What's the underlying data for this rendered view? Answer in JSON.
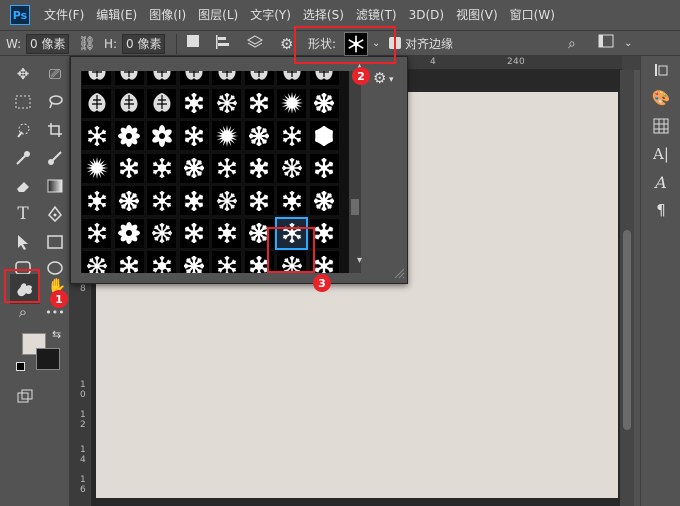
{
  "app": {
    "logo": "Ps"
  },
  "menu": [
    "文件(F)",
    "编辑(E)",
    "图像(I)",
    "图层(L)",
    "文字(Y)",
    "选择(S)",
    "滤镜(T)",
    "3D(D)",
    "视图(V)",
    "窗口(W)"
  ],
  "options": {
    "w_label": "W:",
    "w_value": "0 像素",
    "h_label": "H:",
    "h_value": "0 像素",
    "shape_label": "形状:",
    "align_edges_label": "对齐边缘"
  },
  "rulers": {
    "top": [
      "4",
      "2",
      "4",
      "0"
    ],
    "left": [
      "8",
      "1",
      "0",
      "1",
      "2",
      "1",
      "4",
      "1",
      "6"
    ]
  },
  "annotations": [
    "1",
    "2",
    "3"
  ],
  "colors": {
    "ui_bg": "#535353",
    "canvas": "#e1dbd5",
    "highlight": "#e8232a",
    "selection": "#31a8ff",
    "foreground_swatch": "#e1dbd5",
    "background_swatch": "#1a1a1a"
  },
  "shape_grid": {
    "rows": 7,
    "cols": 8,
    "selected_row": 5,
    "selected_col": 6,
    "row_kinds": [
      [
        "ornament",
        "ornament",
        "ornament",
        "ornament",
        "ornament",
        "ornament",
        "ornament",
        "ornament"
      ],
      [
        "ornament",
        "ornament",
        "ornament",
        "snowflake",
        "snowflake",
        "snowflake",
        "burst",
        "snowflake"
      ],
      [
        "snowflake",
        "flower",
        "flower",
        "snowflake",
        "burst",
        "snowflake",
        "snowflake",
        "hexagon"
      ],
      [
        "burst",
        "snowflake",
        "snowflake",
        "snowflake",
        "snowflake",
        "snowflake",
        "snowflake",
        "snowflake"
      ],
      [
        "snowflake",
        "snowflake",
        "snowflake",
        "snowflake",
        "snowflake",
        "snowflake",
        "snowflake",
        "snowflake"
      ],
      [
        "snowflake",
        "flower",
        "snowflake",
        "snowflake",
        "snowflake",
        "snowflake",
        "snowflake",
        "snowflake"
      ],
      [
        "snowflake",
        "snowflake",
        "snowflake",
        "snowflake",
        "snowflake",
        "snowflake",
        "snowflake",
        "snowflake"
      ]
    ]
  }
}
